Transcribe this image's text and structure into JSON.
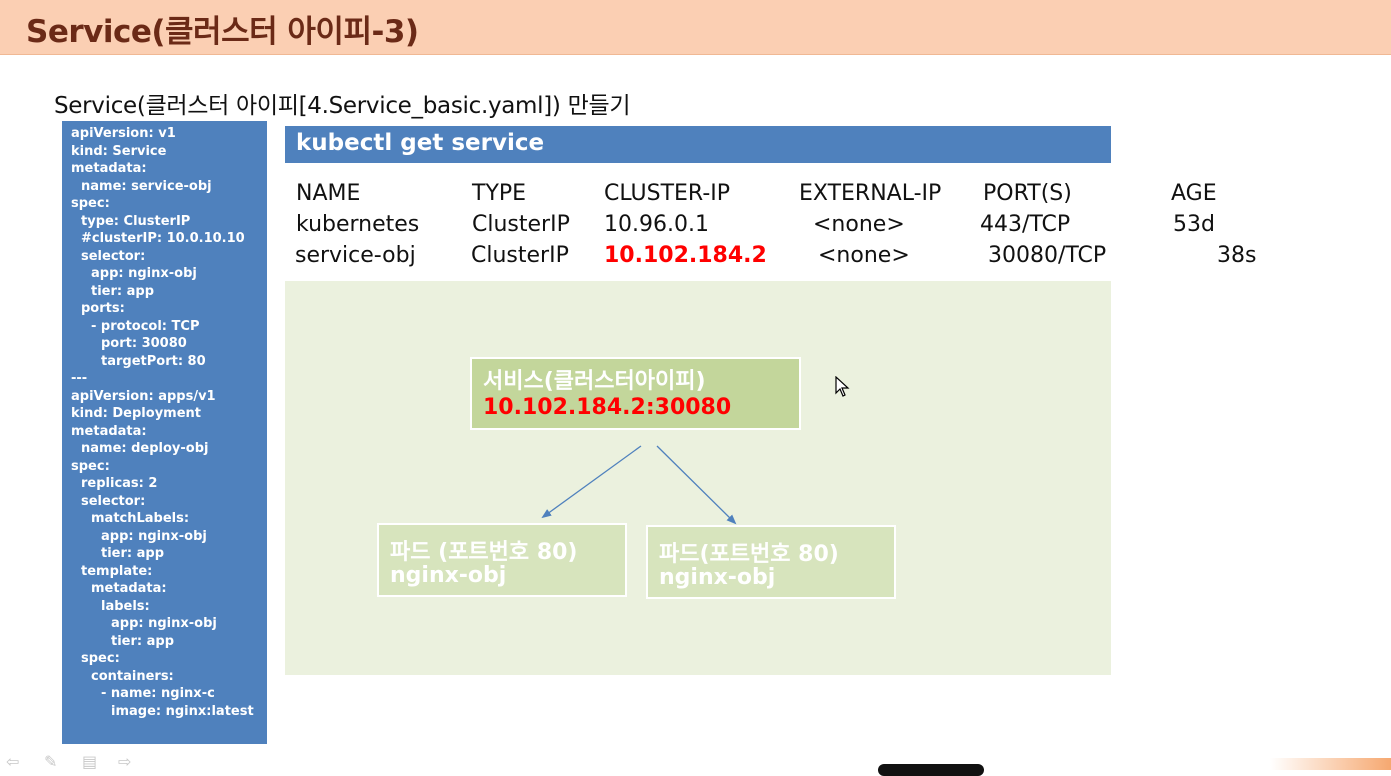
{
  "slide": {
    "title": "Service(클러스터 아이피-3)",
    "subtitle": "Service(클러스터 아이피[4.Service_basic.yaml]) 만들기"
  },
  "yaml": {
    "lines": [
      "apiVersion: v1",
      "kind: Service",
      "metadata:",
      "  name: service-obj",
      "spec:",
      "  type: ClusterIP",
      "  #clusterIP: 10.0.10.10",
      "  selector:",
      "    app: nginx-obj",
      "    tier: app",
      "  ports:",
      "    - protocol:  TCP",
      "      port:  30080",
      "      targetPort:  80",
      "---",
      "apiVersion: apps/v1",
      "kind: Deployment",
      "metadata:",
      "  name: deploy-obj",
      "spec:",
      "  replicas: 2",
      "  selector:",
      "    matchLabels:",
      "      app:  nginx-obj",
      "      tier: app",
      "  template:",
      "    metadata:",
      "      labels:",
      "        app:  nginx-obj",
      "        tier: app",
      "  spec:",
      "    containers:",
      "      - name:  nginx-c",
      "        image:  nginx:latest"
    ]
  },
  "command": {
    "text": "kubectl get service"
  },
  "service_table": {
    "headers": [
      "NAME",
      "TYPE",
      "CLUSTER-IP",
      "EXTERNAL-IP",
      "PORT(S)",
      "AGE"
    ],
    "rows": [
      [
        "kubernetes",
        "ClusterIP",
        "10.96.0.1",
        "<none>",
        "443/TCP",
        "53d"
      ],
      [
        "service-obj",
        "ClusterIP",
        "10.102.184.2",
        "<none>",
        "30080/TCP",
        "38s"
      ]
    ]
  },
  "diagram": {
    "service": {
      "title": "서비스(클러스터아이피)",
      "address": "10.102.184.2:30080"
    },
    "pods": [
      {
        "title": "파드 (포트번호 80)",
        "name": "nginx-obj"
      },
      {
        "title": "파드(포트번호 80)",
        "name": "nginx-obj"
      }
    ]
  },
  "colors": {
    "title_bar": "#fbcfb3",
    "title_text": "#6b2a17",
    "blue_panel": "#4f81bd",
    "highlight_red": "#ff0000",
    "diagram_bg": "#ebf1de",
    "service_box": "#c3d69b",
    "pod_box": "#d7e4bd"
  },
  "icons": [
    "prev-arrow-icon",
    "pen-icon",
    "menu-icon",
    "next-arrow-icon",
    "mouse-cursor-icon"
  ]
}
